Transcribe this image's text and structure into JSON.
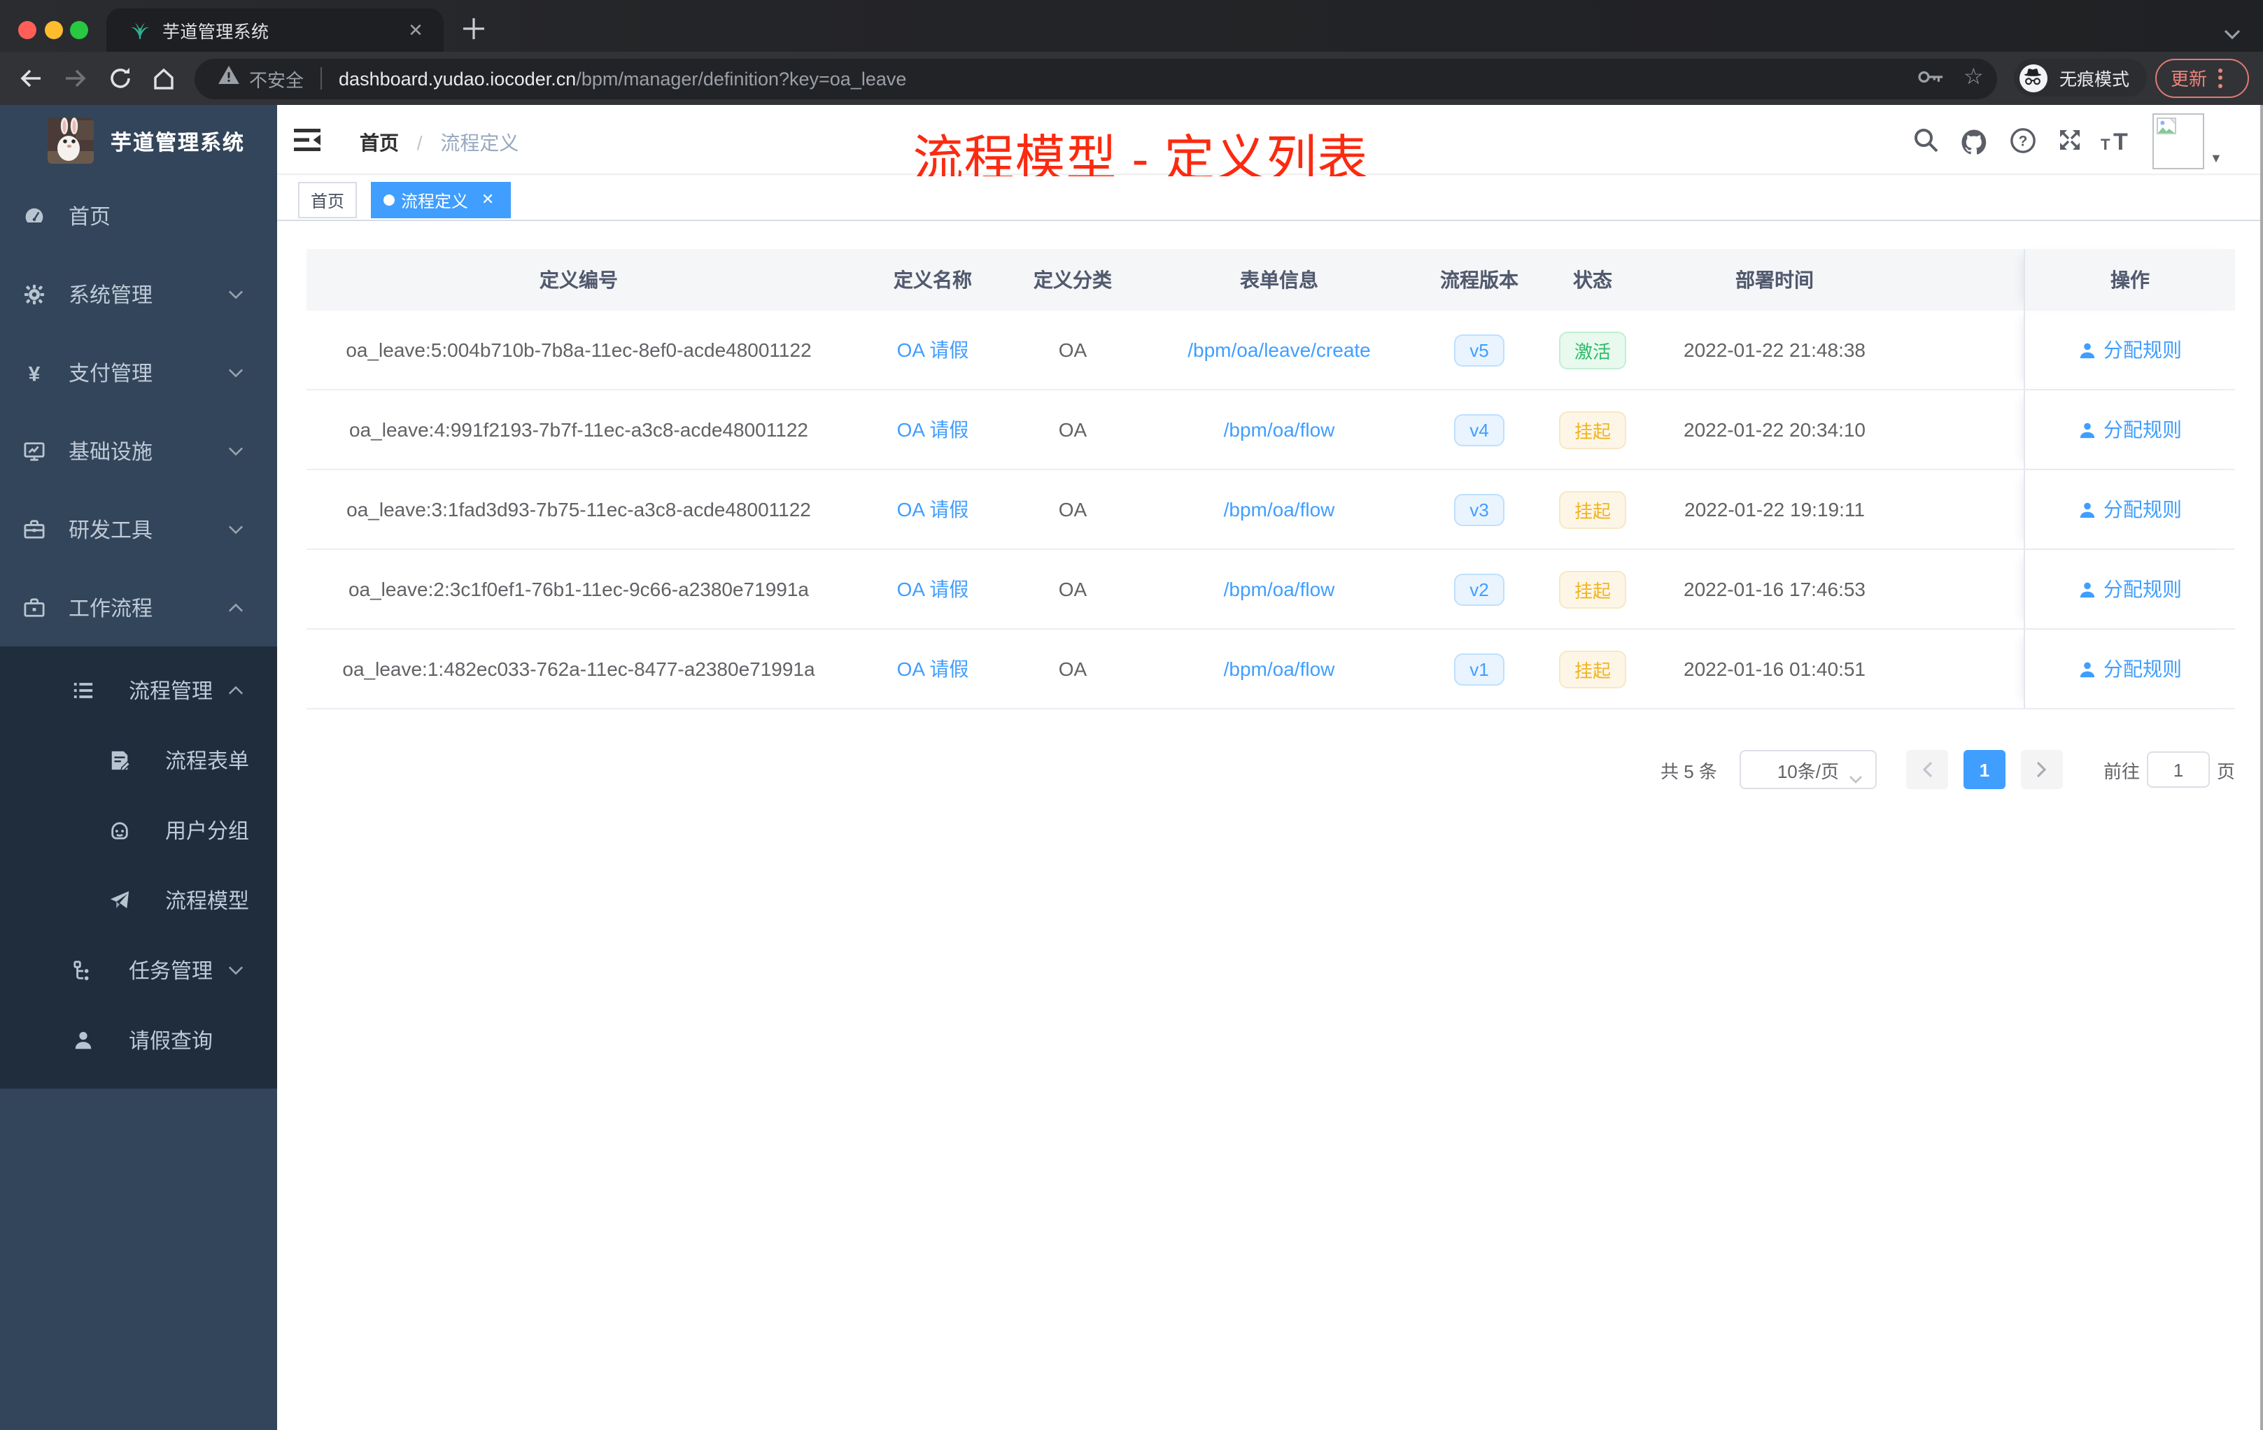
{
  "browser": {
    "tab_title": "芋道管理系统",
    "url_warning": "不安全",
    "url_host": "dashboard.yudao.iocoder.cn",
    "url_path": "/bpm/manager/definition?key=oa_leave",
    "incognito_label": "无痕模式",
    "update_label": "更新"
  },
  "sidebar": {
    "logo_title": "芋道管理系统",
    "menu": [
      {
        "label": "首页",
        "icon": "dashboard-icon",
        "arrow": ""
      },
      {
        "label": "系统管理",
        "icon": "gear-icon",
        "arrow": "down"
      },
      {
        "label": "支付管理",
        "icon": "yen-icon",
        "arrow": "down"
      },
      {
        "label": "基础设施",
        "icon": "monitor-icon",
        "arrow": "down"
      },
      {
        "label": "研发工具",
        "icon": "toolbox-icon",
        "arrow": "down"
      },
      {
        "label": "工作流程",
        "icon": "briefcase-icon",
        "arrow": "up"
      }
    ],
    "submenu": [
      {
        "label": "流程管理",
        "icon": "list-icon",
        "arrow": "up",
        "level": 1
      },
      {
        "label": "流程表单",
        "icon": "form-icon",
        "arrow": "",
        "level": 2
      },
      {
        "label": "用户分组",
        "icon": "robot-icon",
        "arrow": "",
        "level": 2
      },
      {
        "label": "流程模型",
        "icon": "send-icon",
        "arrow": "",
        "level": 2
      },
      {
        "label": "任务管理",
        "icon": "tree-icon",
        "arrow": "down",
        "level": 1
      },
      {
        "label": "请假查询",
        "icon": "user-icon",
        "arrow": "",
        "level": 1
      }
    ]
  },
  "header": {
    "breadcrumb_home": "首页",
    "breadcrumb_sep": "/",
    "breadcrumb_current": "流程定义",
    "annotation": "流程模型 - 定义列表"
  },
  "tags": [
    {
      "label": "首页",
      "active": false,
      "closable": false
    },
    {
      "label": "流程定义",
      "active": true,
      "closable": true
    }
  ],
  "table": {
    "headers": [
      "定义编号",
      "定义名称",
      "定义分类",
      "表单信息",
      "流程版本",
      "状态",
      "部署时间",
      "操作"
    ],
    "action_label": "分配规则",
    "rows": [
      {
        "id": "oa_leave:5:004b710b-7b8a-11ec-8ef0-acde48001122",
        "name": "OA 请假",
        "category": "OA",
        "form": "/bpm/oa/leave/create",
        "version": "v5",
        "status": "激活",
        "status_type": "success",
        "time": "2022-01-22 21:48:38"
      },
      {
        "id": "oa_leave:4:991f2193-7b7f-11ec-a3c8-acde48001122",
        "name": "OA 请假",
        "category": "OA",
        "form": "/bpm/oa/flow",
        "version": "v4",
        "status": "挂起",
        "status_type": "warning",
        "time": "2022-01-22 20:34:10"
      },
      {
        "id": "oa_leave:3:1fad3d93-7b75-11ec-a3c8-acde48001122",
        "name": "OA 请假",
        "category": "OA",
        "form": "/bpm/oa/flow",
        "version": "v3",
        "status": "挂起",
        "status_type": "warning",
        "time": "2022-01-22 19:19:11"
      },
      {
        "id": "oa_leave:2:3c1f0ef1-76b1-11ec-9c66-a2380e71991a",
        "name": "OA 请假",
        "category": "OA",
        "form": "/bpm/oa/flow",
        "version": "v2",
        "status": "挂起",
        "status_type": "warning",
        "time": "2022-01-16 17:46:53"
      },
      {
        "id": "oa_leave:1:482ec033-762a-11ec-8477-a2380e71991a",
        "name": "OA 请假",
        "category": "OA",
        "form": "/bpm/oa/flow",
        "version": "v1",
        "status": "挂起",
        "status_type": "warning",
        "time": "2022-01-16 01:40:51"
      }
    ]
  },
  "pagination": {
    "total": "共 5 条",
    "page_size": "10条/页",
    "current_page": "1",
    "goto_label": "前往",
    "goto_value": "1",
    "page_unit": "页"
  },
  "colors": {
    "accent": "#409eff",
    "sidebar_bg": "#33455a",
    "submenu_bg": "#1f2d3d",
    "annotation_red": "#fb2a10",
    "status_active_green": "#2ebd68",
    "status_suspend_yellow": "#f0b322",
    "traffic_red": "#ff5f57",
    "traffic_yellow": "#febc2e",
    "traffic_green": "#28c840"
  }
}
